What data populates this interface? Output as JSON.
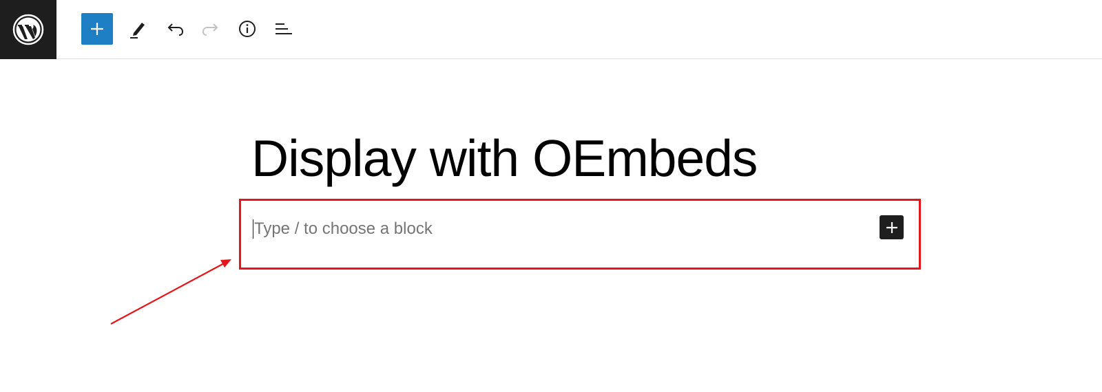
{
  "toolbar": {
    "logo_icon": "wordpress-logo",
    "buttons": [
      {
        "icon": "plus-icon",
        "label": "Add block"
      },
      {
        "icon": "pencil-icon",
        "label": "Tools"
      },
      {
        "icon": "undo-icon",
        "label": "Undo"
      },
      {
        "icon": "redo-icon",
        "label": "Redo",
        "disabled": true
      },
      {
        "icon": "info-icon",
        "label": "Details"
      },
      {
        "icon": "list-view-icon",
        "label": "List View"
      }
    ]
  },
  "editor": {
    "title": "Display with OEmbeds",
    "block_placeholder": "Type / to choose a block",
    "block_value": "",
    "inserter_icon": "plus-icon"
  },
  "annotation": {
    "highlight_color": "#e8141b",
    "arrow_color": "#e8141b"
  },
  "colors": {
    "accent": "#1e7fc4",
    "dark": "#1e1e1e",
    "disabled": "#c3c3c3"
  }
}
